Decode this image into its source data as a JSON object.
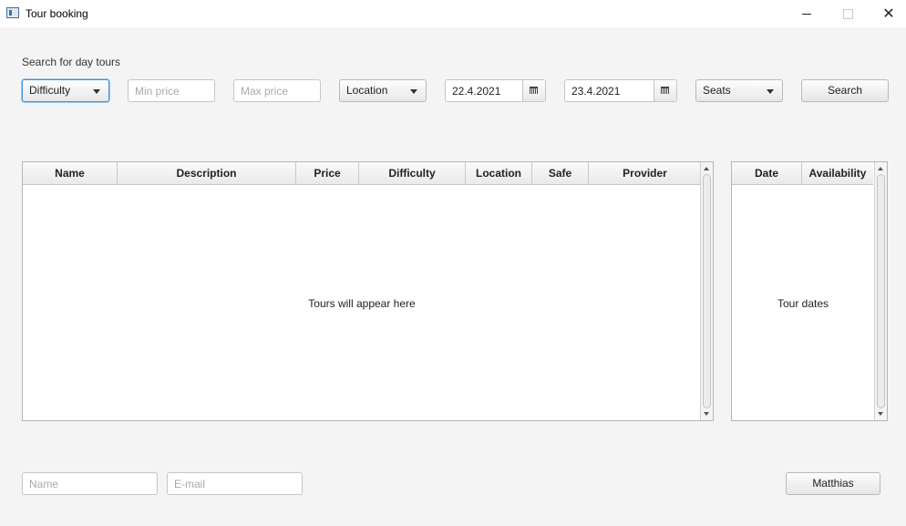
{
  "window": {
    "title": "Tour booking"
  },
  "search": {
    "heading": "Search for day tours",
    "difficulty": "Difficulty",
    "min_price_placeholder": "Min price",
    "max_price_placeholder": "Max price",
    "location": "Location",
    "date_from": "22.4.2021",
    "date_to": "23.4.2021",
    "seats": "Seats",
    "search_button": "Search"
  },
  "tours_table": {
    "columns": [
      "Name",
      "Description",
      "Price",
      "Difficulty",
      "Location",
      "Safe",
      "Provider"
    ],
    "placeholder": "Tours will appear here"
  },
  "dates_table": {
    "columns": [
      "Date",
      "Availability"
    ],
    "placeholder": "Tour dates"
  },
  "booking": {
    "name_placeholder": "Name",
    "email_placeholder": "E-mail",
    "user_button": "Matthias"
  },
  "colors": {
    "focus": "#3c8fd6",
    "background": "#f4f4f4"
  }
}
